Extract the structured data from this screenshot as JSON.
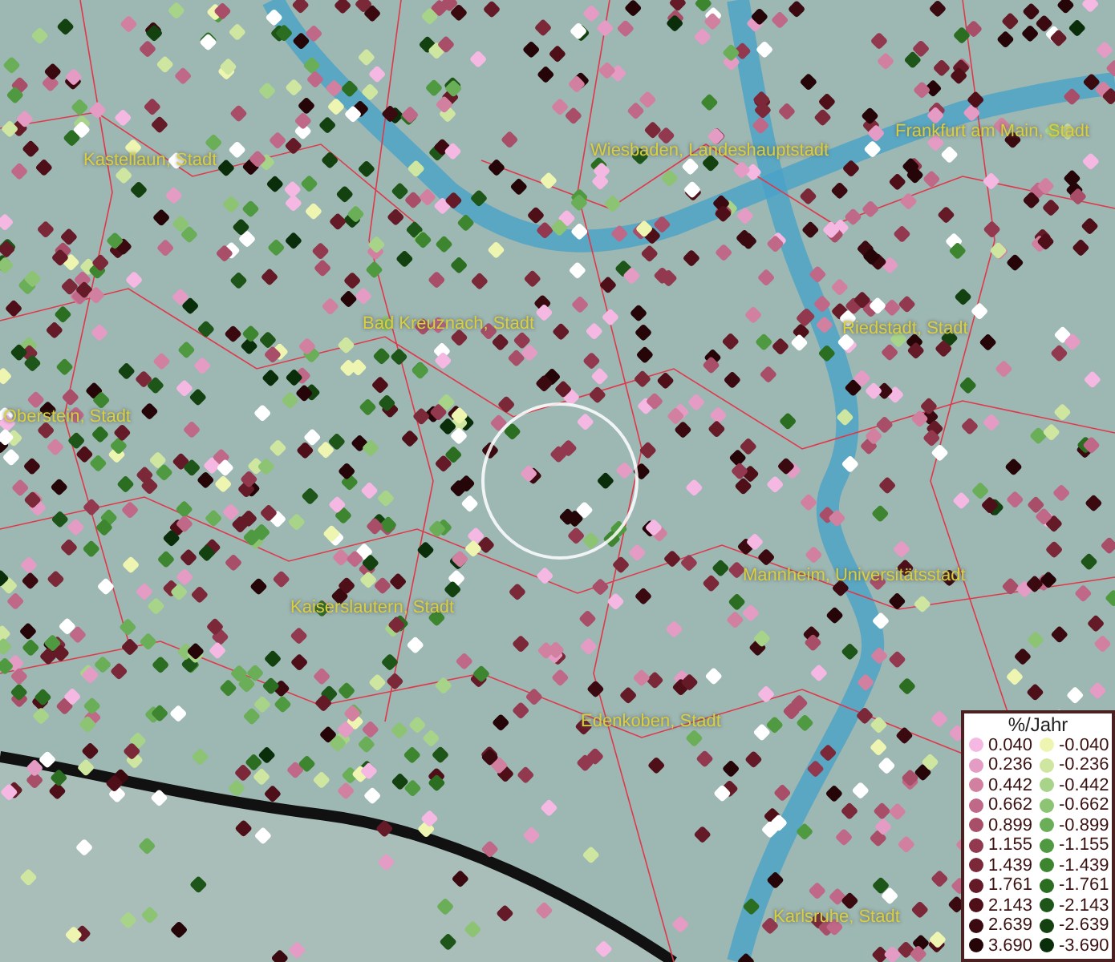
{
  "map": {
    "place_labels": [
      "Kastellaun, Stadt",
      "Wiesbaden, Landeshauptstadt",
      "Frankfurt am Main, Stadt",
      "Bad Kreuznach, Stadt",
      "Riedstadt, Stadt",
      "Oberstein, Stadt",
      "Mannheim, Universitätsstadt",
      "Kaiserslautern, Stadt",
      "Edenkoben, Stadt",
      "Karlsruhe, Stadt"
    ]
  },
  "legend": {
    "title": "%/Jahr",
    "positive": [
      {
        "label": "0.040",
        "color": "#f5b8e3"
      },
      {
        "label": "0.236",
        "color": "#e59cc4"
      },
      {
        "label": "0.442",
        "color": "#d2809f"
      },
      {
        "label": "0.662",
        "color": "#c06887"
      },
      {
        "label": "0.899",
        "color": "#a84e69"
      },
      {
        "label": "1.155",
        "color": "#923950"
      },
      {
        "label": "1.439",
        "color": "#7b2839"
      },
      {
        "label": "1.761",
        "color": "#651a27"
      },
      {
        "label": "2.143",
        "color": "#4e0f18"
      },
      {
        "label": "2.639",
        "color": "#3a0a10"
      },
      {
        "label": "3.690",
        "color": "#260508"
      }
    ],
    "negative": [
      {
        "label": "-0.040",
        "color": "#eef5b0"
      },
      {
        "label": "-0.236",
        "color": "#cfe6a0"
      },
      {
        "label": "-0.442",
        "color": "#a8d48a"
      },
      {
        "label": "-0.662",
        "color": "#8cc473"
      },
      {
        "label": "-0.899",
        "color": "#6aae58"
      },
      {
        "label": "-1.155",
        "color": "#4f9a40"
      },
      {
        "label": "-1.439",
        "color": "#3d862f"
      },
      {
        "label": "-1.761",
        "color": "#2b6e22"
      },
      {
        "label": "-2.143",
        "color": "#1d5618"
      },
      {
        "label": "-2.639",
        "color": "#134210"
      },
      {
        "label": "-3.690",
        "color": "#0b2e0a"
      }
    ]
  }
}
